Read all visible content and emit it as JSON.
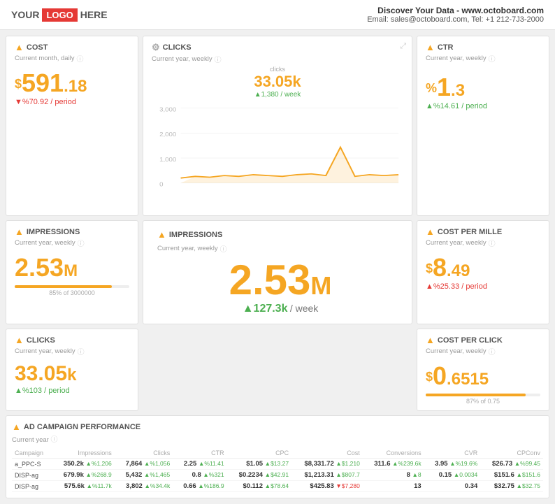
{
  "header": {
    "logo_before": "YOUR",
    "logo_text": "LOGO",
    "logo_after": "HERE",
    "site_label": "Discover Your Data - www.octoboard.com",
    "email_label": "Email: sales@octoboard.com, Tel: +1 212-7J3-2000"
  },
  "cost_card": {
    "icon": "▲",
    "title": "COST",
    "subtitle": "Current month, daily",
    "currency": "$",
    "whole": "591",
    "decimal": ".18",
    "change_label": "▼%70.92 / period",
    "change_type": "down"
  },
  "clicks_card": {
    "title": "CLICKS",
    "subtitle": "Current year, weekly",
    "chart_label": "clicks",
    "big_value": "33.05k",
    "week_change": "▲1,380",
    "week_label": "/ week"
  },
  "ctr_card": {
    "icon": "▲",
    "title": "CTR",
    "subtitle": "Current year, weekly",
    "pct": "%",
    "whole": "1",
    "decimal": ".3",
    "change_label": "▲%14.61 / period",
    "change_type": "up"
  },
  "impressions_small_card": {
    "icon": "▲",
    "title": "IMPRESSIONS",
    "subtitle": "Current year, weekly",
    "value": "2.53",
    "unit": "M",
    "progress_pct": 85,
    "progress_label": "85% of 3000000"
  },
  "impressions_big_card": {
    "icon": "▲",
    "title": "IMPRESSIONS",
    "subtitle": "Current year, weekly",
    "big_num": "2.53",
    "unit": "M",
    "week_change": "▲127.3k",
    "week_label": "/ week"
  },
  "cost_per_mille_card": {
    "icon": "▲",
    "title": "COST PER MILLE",
    "subtitle": "Current year, weekly",
    "currency": "$",
    "whole": "8",
    "decimal": ".49",
    "change_label": "▲%25.33 / period",
    "change_type": "down"
  },
  "clicks_small_card": {
    "icon": "▲",
    "title": "CLICKS",
    "subtitle": "Current year, weekly",
    "value": "33.05",
    "unit": "k",
    "change_label": "▲%103 / period",
    "change_type": "up"
  },
  "cost_per_click_card": {
    "icon": "▲",
    "title": "COST PER CLICK",
    "subtitle": "Current year, weekly",
    "currency": "$",
    "whole": "0",
    "decimal": ".6515",
    "progress_pct": 87,
    "progress_label": "87% of 0.75"
  },
  "ad_campaign": {
    "icon": "▲",
    "title": "AD CAMPAIGN PERFORMANCE",
    "subtitle": "Current year",
    "columns": [
      "Campaign",
      "Impressions",
      "Clicks",
      "CTR",
      "CPC",
      "Cost",
      "Conversions",
      "CVR",
      "CPConv"
    ],
    "rows": [
      {
        "campaign": "a_PPC-S",
        "impressions": "350.2k",
        "impressions_change": "▲%1,206",
        "impressions_dir": "up",
        "clicks": "7,864",
        "clicks_change": "▲%1,056",
        "clicks_dir": "up",
        "ctr": "2.25",
        "ctr_change": "▲%11.41",
        "ctr_dir": "up",
        "cpc": "$1.05",
        "cpc_change": "▲$13.27",
        "cpc_dir": "up",
        "cost": "$8,331.72",
        "cost_change": "▲$1,210",
        "cost_dir": "up",
        "conv": "311.6",
        "conv_change": "▲%239.6k",
        "conv_dir": "up",
        "cvr": "3.95",
        "cvr_change": "▲%19.6%",
        "cvr_dir": "up",
        "cpconv": "$26.73",
        "cpconv_change": "▲%99.45",
        "cpconv_dir": "up"
      },
      {
        "campaign": "DISP-ag",
        "impressions": "679.9k",
        "impressions_change": "▲%268.9",
        "impressions_dir": "up",
        "clicks": "5,432",
        "clicks_change": "▲%1,465",
        "clicks_dir": "up",
        "ctr": "0.8",
        "ctr_change": "▲%321",
        "ctr_dir": "up",
        "cpc": "$0.2234",
        "cpc_change": "▲$42.91",
        "cpc_dir": "up",
        "cost": "$1,213.31",
        "cost_change": "▲$807.7",
        "cost_dir": "up",
        "conv": "8",
        "conv_change": "▲8",
        "conv_dir": "up",
        "cvr": "0.15",
        "cvr_change": "▲0.0034",
        "cvr_dir": "up",
        "cpconv": "$151.6",
        "cpconv_change": "▲$151.6",
        "cpconv_dir": "up"
      },
      {
        "campaign": "DISP-ag",
        "impressions": "575.6k",
        "impressions_change": "▲%11.7k",
        "impressions_dir": "up",
        "clicks": "3,802",
        "clicks_change": "▲%34.4k",
        "clicks_dir": "up",
        "ctr": "0.66",
        "ctr_change": "▲%186.9",
        "ctr_dir": "up",
        "cpc": "$0.112",
        "cpc_change": "▲$78.64",
        "cpc_dir": "up",
        "cost": "$425.83",
        "cost_change": "▼$7,280",
        "cost_dir": "down",
        "conv": "13",
        "conv_change": "",
        "conv_dir": "",
        "cvr": "0.34",
        "cvr_change": "",
        "cvr_dir": "",
        "cpconv": "$32.75",
        "cpconv_change": "▲$32.75",
        "cpconv_dir": "up"
      }
    ]
  },
  "colors": {
    "orange": "#f5a623",
    "green": "#4caf50",
    "red": "#e53935",
    "light_gray": "#f0f0f0"
  }
}
